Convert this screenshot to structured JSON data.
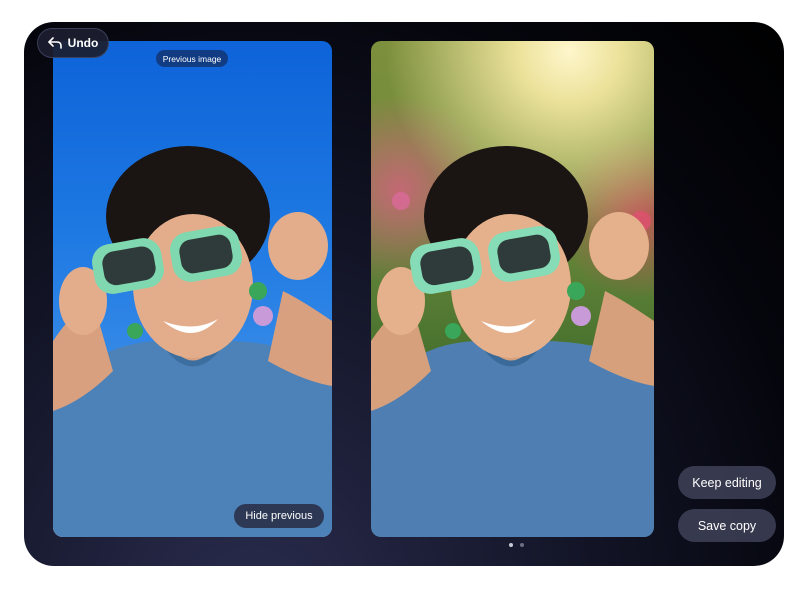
{
  "toolbar": {
    "undo_label": "Undo"
  },
  "preview": {
    "previous_badge": "Previous image",
    "hide_previous_label": "Hide previous"
  },
  "actions": {
    "keep_editing_label": "Keep editing",
    "save_copy_label": "Save copy"
  },
  "pager": {
    "page_count": 2,
    "active_index": 0
  },
  "icons": {
    "undo": "undo-arrow-icon"
  }
}
